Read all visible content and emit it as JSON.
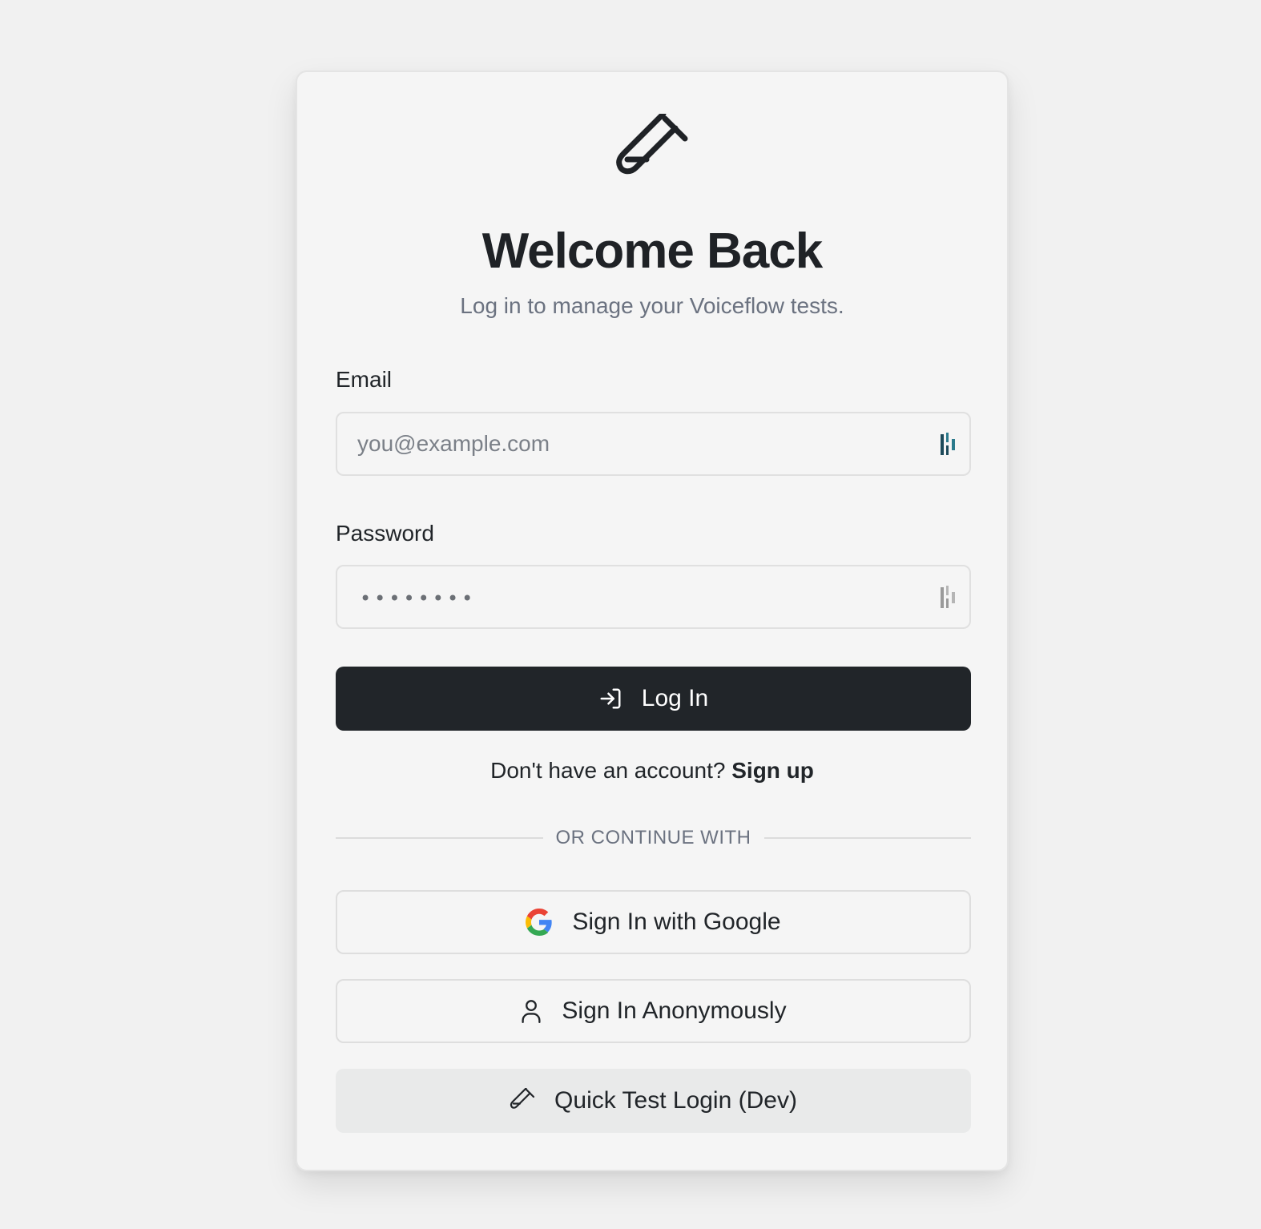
{
  "header": {
    "logo_icon": "test-tube-icon",
    "title": "Welcome Back",
    "subtitle": "Log in to manage your Voiceflow tests."
  },
  "form": {
    "email_label": "Email",
    "email_placeholder": "you@example.com",
    "email_value": "",
    "password_label": "Password",
    "password_mask": "••••••••",
    "password_manager_icon": "password-manager-icon"
  },
  "actions": {
    "login_label": "Log In",
    "login_icon": "log-in-icon",
    "signup_prompt": "Don't have an account?",
    "signup_link": "Sign up",
    "divider_text": "OR CONTINUE WITH",
    "google_label": "Sign In with Google",
    "google_icon": "google-icon",
    "anonymous_label": "Sign In Anonymously",
    "anonymous_icon": "user-icon",
    "dev_label": "Quick Test Login (Dev)",
    "dev_icon": "test-tube-icon"
  },
  "colors": {
    "primary_button": "#212529",
    "background": "#f1f1f1",
    "card": "#f5f5f5",
    "muted_text": "#6b7280"
  }
}
